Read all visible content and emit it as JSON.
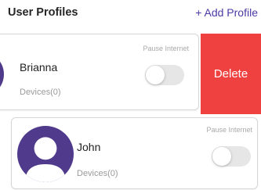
{
  "header": {
    "title": "User Profiles",
    "add_label": "+ Add Profile"
  },
  "profiles": [
    {
      "name": "Brianna",
      "devices": "Devices(0)",
      "pause_label": "Pause Internet",
      "pause_enabled": false,
      "avatar_icon": "user-avatar-icon",
      "swipe_action": "Delete"
    },
    {
      "name": "John",
      "devices": "Devices(0)",
      "pause_label": "Pause Internet",
      "pause_enabled": false,
      "avatar_icon": "user-avatar-icon"
    }
  ],
  "colors": {
    "accent": "#4a3aa6",
    "avatar_bg": "#4f3a8c",
    "delete_bg": "#ef4240",
    "toggle_off": "#e6e6e6"
  }
}
